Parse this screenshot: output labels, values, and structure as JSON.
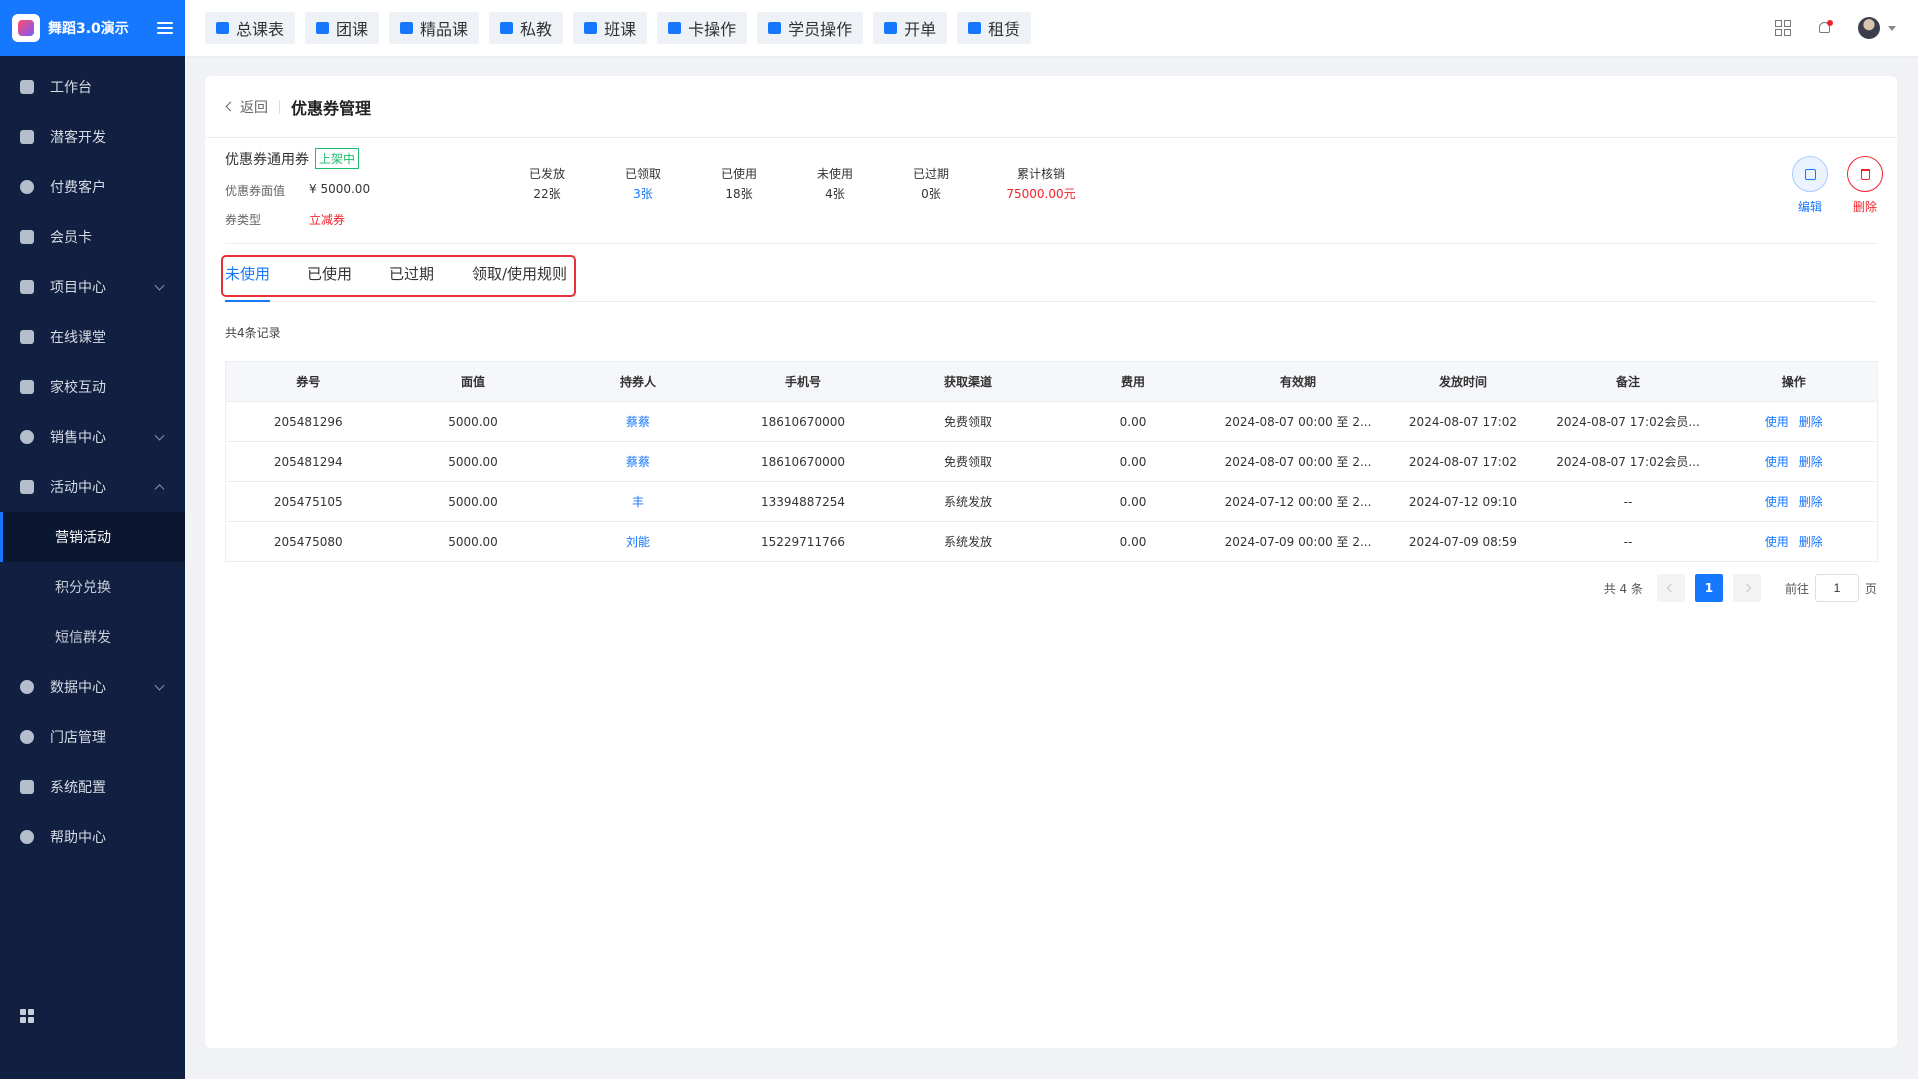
{
  "brand": {
    "name": "舞蹈3.0演示"
  },
  "sidebar": {
    "items": [
      {
        "label": "工作台"
      },
      {
        "label": "潜客开发"
      },
      {
        "label": "付费客户"
      },
      {
        "label": "会员卡"
      },
      {
        "label": "项目中心"
      },
      {
        "label": "在线课堂"
      },
      {
        "label": "家校互动"
      },
      {
        "label": "销售中心"
      },
      {
        "label": "活动中心"
      },
      {
        "label": "营销活动"
      },
      {
        "label": "积分兑换"
      },
      {
        "label": "短信群发"
      },
      {
        "label": "数据中心"
      },
      {
        "label": "门店管理"
      },
      {
        "label": "系统配置"
      },
      {
        "label": "帮助中心"
      }
    ]
  },
  "topbar": {
    "quick": [
      {
        "label": "总课表"
      },
      {
        "label": "团课"
      },
      {
        "label": "精品课"
      },
      {
        "label": "私教"
      },
      {
        "label": "班课"
      },
      {
        "label": "卡操作"
      },
      {
        "label": "学员操作"
      },
      {
        "label": "开单"
      },
      {
        "label": "租赁"
      }
    ]
  },
  "page": {
    "back": "返回",
    "title": "优惠券管理"
  },
  "coupon": {
    "name": "优惠券通用券",
    "status": "上架中",
    "value_label": "优惠券面值",
    "value": "¥ 5000.00",
    "type_label": "券类型",
    "type": "立减券",
    "stats": [
      {
        "label": "已发放",
        "value": "22张"
      },
      {
        "label": "已领取",
        "value": "3张"
      },
      {
        "label": "已使用",
        "value": "18张"
      },
      {
        "label": "未使用",
        "value": "4张"
      },
      {
        "label": "已过期",
        "value": "0张"
      },
      {
        "label": "累计核销",
        "value": "75000.00元"
      }
    ],
    "edit": "编辑",
    "delete": "删除"
  },
  "tabs": [
    {
      "label": "未使用"
    },
    {
      "label": "已使用"
    },
    {
      "label": "已过期"
    },
    {
      "label": "领取/使用规则"
    }
  ],
  "record_count": "共4条记录",
  "table": {
    "columns": [
      "券号",
      "面值",
      "持券人",
      "手机号",
      "获取渠道",
      "费用",
      "有效期",
      "发放时间",
      "备注",
      "操作"
    ],
    "rows": [
      {
        "no": "205481296",
        "value": "5000.00",
        "holder": "蔡蔡",
        "phone": "18610670000",
        "channel": "免费领取",
        "fee": "0.00",
        "validity": "2024-08-07 00:00 至 2...",
        "issued": "2024-08-07 17:02",
        "remark": "2024-08-07 17:02会员...",
        "use": "使用",
        "del": "删除"
      },
      {
        "no": "205481294",
        "value": "5000.00",
        "holder": "蔡蔡",
        "phone": "18610670000",
        "channel": "免费领取",
        "fee": "0.00",
        "validity": "2024-08-07 00:00 至 2...",
        "issued": "2024-08-07 17:02",
        "remark": "2024-08-07 17:02会员...",
        "use": "使用",
        "del": "删除"
      },
      {
        "no": "205475105",
        "value": "5000.00",
        "holder": "丰",
        "phone": "13394887254",
        "channel": "系统发放",
        "fee": "0.00",
        "validity": "2024-07-12 00:00 至 2...",
        "issued": "2024-07-12 09:10",
        "remark": "--",
        "use": "使用",
        "del": "删除"
      },
      {
        "no": "205475080",
        "value": "5000.00",
        "holder": "刘能",
        "phone": "15229711766",
        "channel": "系统发放",
        "fee": "0.00",
        "validity": "2024-07-09 00:00 至 2...",
        "issued": "2024-07-09 08:59",
        "remark": "--",
        "use": "使用",
        "del": "删除"
      }
    ]
  },
  "pager": {
    "total": "共 4 条",
    "current": "1",
    "goto_prefix": "前往",
    "goto_value": "1",
    "goto_suffix": "页"
  },
  "colors": {
    "accent": "#1677ff",
    "sidebar_bg": "#112040",
    "danger": "#f5222d",
    "success": "#19be6b"
  }
}
